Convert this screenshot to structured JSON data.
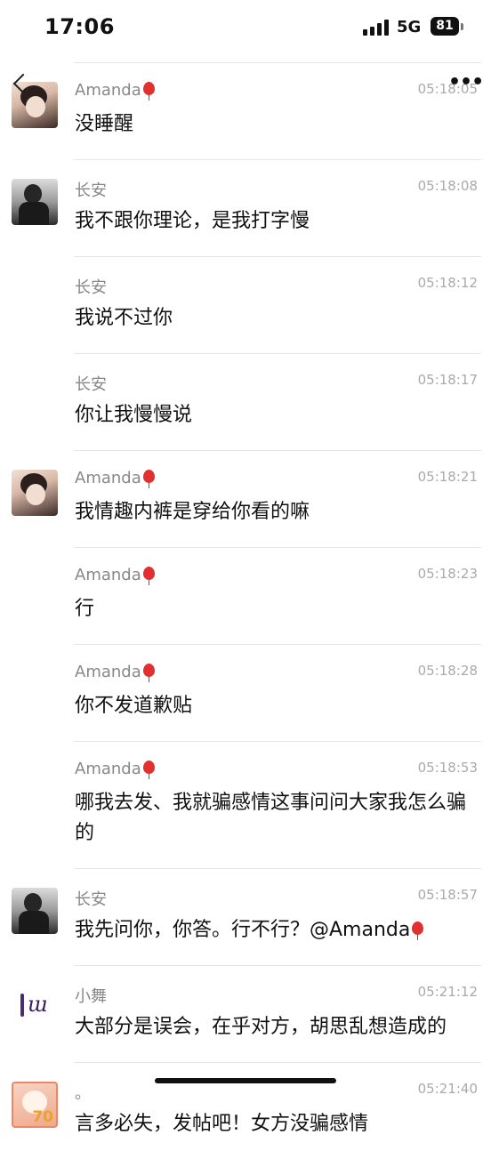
{
  "status": {
    "time": "17:06",
    "network": "5G",
    "battery": "81"
  },
  "messages": [
    {
      "sender": "Amanda",
      "balloon": true,
      "time": "05:18:05",
      "text": "没睡醒",
      "avatar": "amanda"
    },
    {
      "sender": "长安",
      "balloon": false,
      "time": "05:18:08",
      "text": "我不跟你理论，是我打字慢",
      "avatar": "changan"
    },
    {
      "sender": "长安",
      "balloon": false,
      "time": "05:18:12",
      "text": "我说不过你",
      "avatar": ""
    },
    {
      "sender": "长安",
      "balloon": false,
      "time": "05:18:17",
      "text": "你让我慢慢说",
      "avatar": ""
    },
    {
      "sender": "Amanda",
      "balloon": true,
      "time": "05:18:21",
      "text": "我情趣内裤是穿给你看的嘛",
      "avatar": "amanda"
    },
    {
      "sender": "Amanda",
      "balloon": true,
      "time": "05:18:23",
      "text": "行",
      "avatar": ""
    },
    {
      "sender": "Amanda",
      "balloon": true,
      "time": "05:18:28",
      "text": "你不发道歉贴",
      "avatar": ""
    },
    {
      "sender": "Amanda",
      "balloon": true,
      "time": "05:18:53",
      "text": "哪我去发、我就骗感情这事问问大家我怎么骗的",
      "avatar": ""
    },
    {
      "sender": "长安",
      "balloon": false,
      "time": "05:18:57",
      "text": "我先问你，你答。行不行？@Amanda",
      "text_balloon": true,
      "avatar": "changan"
    },
    {
      "sender": "小舞",
      "balloon": false,
      "time": "05:21:12",
      "text": "大部分是误会，在乎对方，胡思乱想造成的",
      "avatar": "xiaowu"
    },
    {
      "sender": "。",
      "balloon": false,
      "time": "05:21:40",
      "text": "言多必失，发帖吧！女方没骗感情",
      "avatar": "seven"
    }
  ],
  "icons": {
    "back": "back-chevron-icon",
    "more": "more-dots-icon"
  }
}
